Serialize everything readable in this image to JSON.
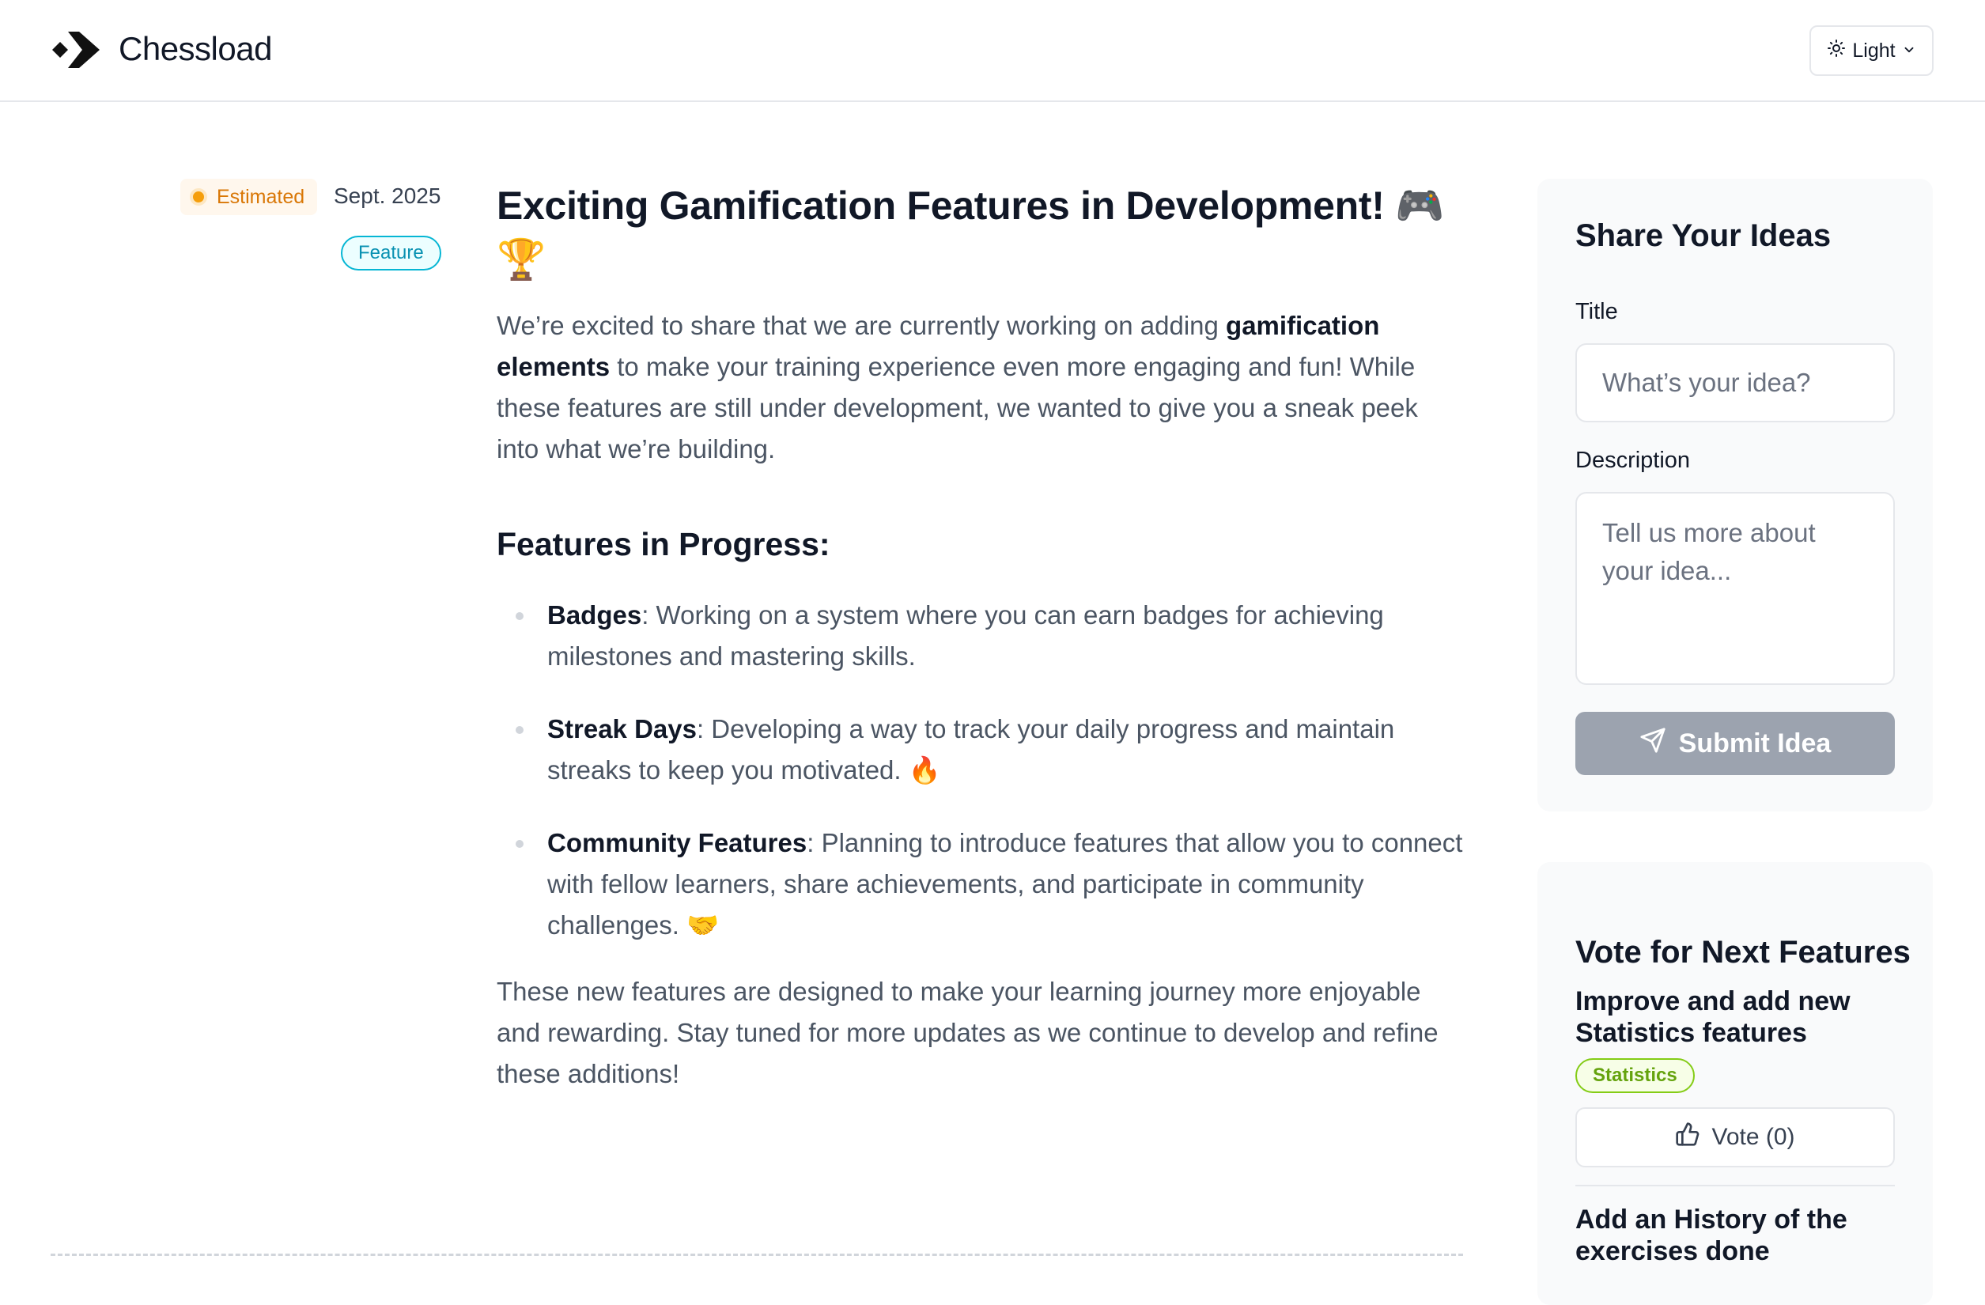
{
  "header": {
    "brand": "Chessload",
    "theme_label": "Light"
  },
  "meta": {
    "status": "Estimated",
    "date": "Sept. 2025",
    "tag": "Feature"
  },
  "article": {
    "title": "Exciting Gamification Features in Development! 🎮🏆",
    "intro_before": "We’re excited to share that we are currently working on adding ",
    "intro_bold": "gamification elements",
    "intro_after": " to make your training experience even more engaging and fun! While these features are still under development, we wanted to give you a sneak peek into what we’re building.",
    "section_heading": "Features in Progress:",
    "items": [
      {
        "name": "Badges",
        "text": ": Working on a system where you can earn badges for achieving milestones and mastering skills."
      },
      {
        "name": "Streak Days",
        "text": ": Developing a way to track your daily progress and maintain streaks to keep you motivated. 🔥"
      },
      {
        "name": "Community Features",
        "text": ": Planning to introduce features that allow you to connect with fellow learners, share achievements, and participate in community challenges. 🤝"
      }
    ],
    "closing": "These new features are designed to make your learning journey more enjoyable and rewarding. Stay tuned for more updates as we continue to develop and refine these additions!"
  },
  "share": {
    "title": "Share Your Ideas",
    "title_label": "Title",
    "title_placeholder": "What’s your idea?",
    "description_label": "Description",
    "description_placeholder": "Tell us more about your idea...",
    "submit_label": "Submit Idea"
  },
  "vote": {
    "title": "Vote for Next Features",
    "items": [
      {
        "title": "Improve and add new Statistics features",
        "tag": "Statistics",
        "vote_label": "Vote (0)"
      },
      {
        "title": "Add an History of the exercises done"
      }
    ]
  },
  "colors": {
    "status": "#f59e0b",
    "feature_tag": "#0891b2",
    "statistics_tag": "#65a30d",
    "submit_disabled": "#9ca3af"
  }
}
